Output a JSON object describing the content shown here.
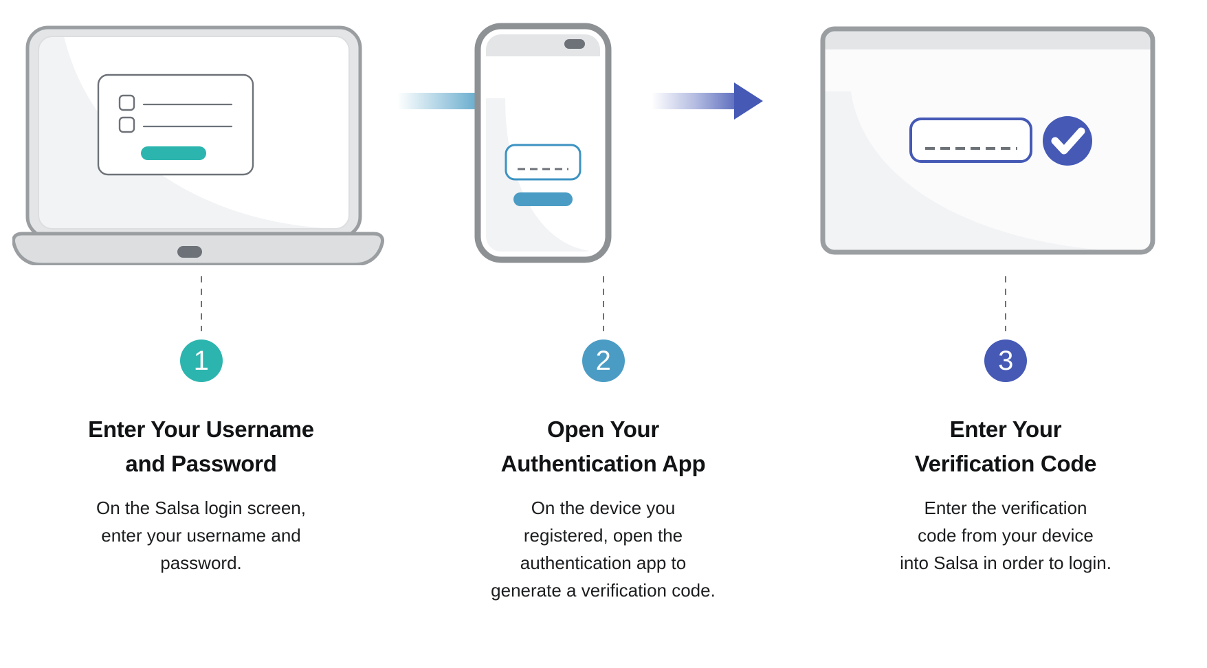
{
  "graphic": {
    "kind": "three-step-infographic",
    "background": "#ffffff"
  },
  "colors": {
    "step1_accent": "#2bb5ae",
    "step2_accent": "#4b9cc4",
    "step3_accent": "#4559b5",
    "device_frame": "#9b9ea1",
    "device_frame_light": "#dcdee0",
    "screen": "#ffffff",
    "screen_shade": "#f2f3f5",
    "outline_gray": "#6d7278",
    "text": "#111315"
  },
  "steps": [
    {
      "number": "1",
      "accent": "#2bb5ae",
      "device": "laptop",
      "device_name": "laptop-illustration",
      "heading": "Enter Your Username and Password",
      "heading_lines": [
        "Enter Your Username",
        "and Password"
      ],
      "body": "On the Salsa login screen, enter your username and password.",
      "body_lines": [
        "On the Salsa login screen,",
        "enter your username and",
        "password."
      ],
      "screen_elements": {
        "card_name": "login-card",
        "checkbox_rows": 2,
        "button_name": "login-submit-button"
      }
    },
    {
      "number": "2",
      "accent": "#4b9cc4",
      "device": "phone",
      "device_name": "phone-illustration",
      "heading": "Open Your Authentication App",
      "heading_lines": [
        "Open Your",
        "Authentication App"
      ],
      "body": "On the device you registered, open the authentication app to generate a verification code.",
      "body_lines": [
        "On the device you",
        "registered, open the",
        "authentication app to",
        "generate a verification code."
      ],
      "screen_elements": {
        "code_field_name": "verification-code-field",
        "code_placeholder_dashes": 5,
        "button_name": "generate-code-button"
      }
    },
    {
      "number": "3",
      "accent": "#4559b5",
      "device": "tablet",
      "device_name": "tablet-illustration",
      "heading": "Enter Your Verification Code",
      "heading_lines": [
        "Enter Your",
        "Verification Code"
      ],
      "body": "Enter the verification code from your device into Salsa in order to login.",
      "body_lines": [
        "Enter the verification",
        "code from your device",
        "into Salsa in order to login."
      ],
      "screen_elements": {
        "code_field_name": "verification-code-entry-field",
        "code_placeholder_dashes": 6,
        "status_icon": "check-circle-icon"
      }
    }
  ],
  "arrows": [
    {
      "name": "flow-arrow-1",
      "from_step": "1",
      "to_step": "2",
      "color": "#4b9cc4",
      "direction": "right"
    },
    {
      "name": "flow-arrow-2",
      "from_step": "2",
      "to_step": "3",
      "color": "#4559b5",
      "direction": "right"
    }
  ]
}
